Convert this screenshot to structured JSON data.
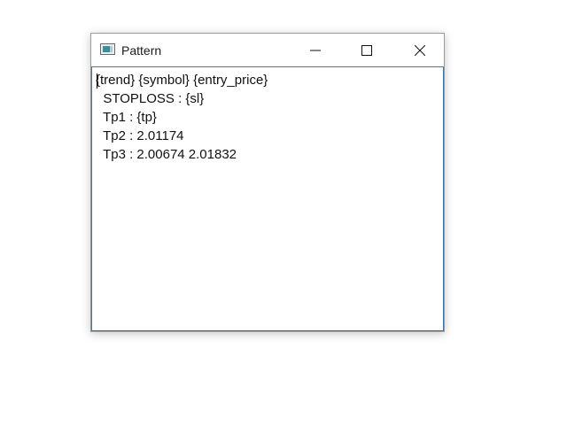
{
  "window": {
    "title": "Pattern",
    "icon": "app-window-icon",
    "controls": {
      "minimize_icon": "minimize-icon",
      "maximize_icon": "maximize-icon",
      "close_icon": "close-icon"
    }
  },
  "editor": {
    "lines": [
      "{trend} {symbol} {entry_price}",
      "  STOPLOSS : {sl}",
      "  Tp1 : {tp}",
      "  Tp2 : 2.01174",
      "  Tp3 : 2.00674 2.01832"
    ]
  },
  "colors": {
    "focus_border": "#3f79a8",
    "text": "#111111"
  }
}
